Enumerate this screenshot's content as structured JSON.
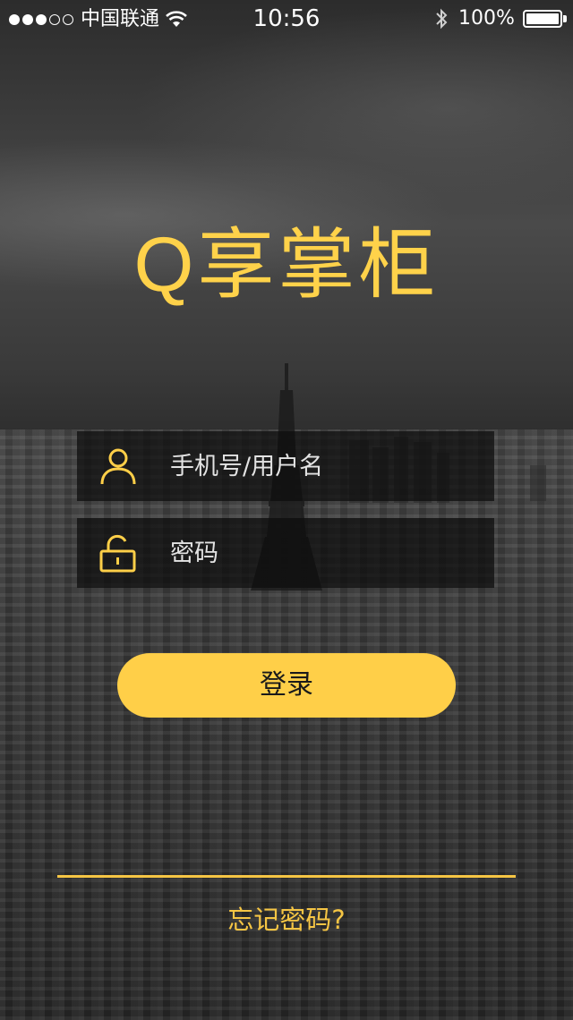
{
  "status_bar": {
    "carrier": "中国联通",
    "time": "10:56",
    "battery_percent": "100%",
    "signal_strength_bars": 3,
    "signal_total_bars": 5,
    "icons": [
      "signal-dots-icon",
      "wifi-icon",
      "bluetooth-icon",
      "battery-icon"
    ]
  },
  "app": {
    "title": "Q享掌柜"
  },
  "login_form": {
    "username_placeholder": "手机号/用户名",
    "password_placeholder": "密码",
    "username_icon": "user-icon",
    "password_icon": "lock-icon",
    "login_label": "登录",
    "forgot_password_label": "忘记密码?"
  },
  "colors": {
    "accent": "#ffcf48",
    "accent_text": "#f5c544",
    "field_background": "#0c0c0c",
    "text_light": "#e8e8e8"
  }
}
